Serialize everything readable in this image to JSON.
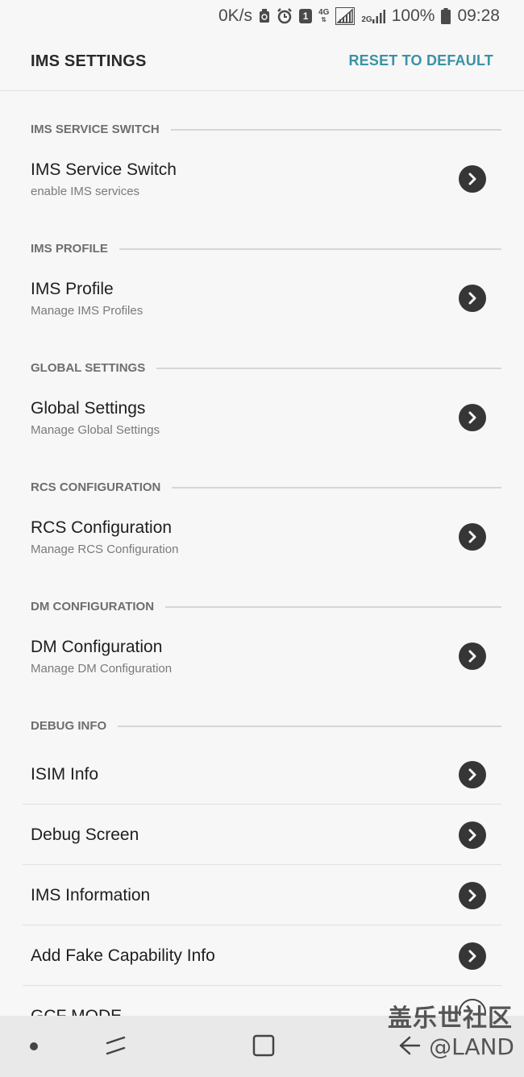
{
  "status_bar": {
    "speed": "0K/s",
    "sim_badge": "1",
    "net_4g": "4G",
    "net_2g": "2G",
    "battery": "100%",
    "time": "09:28",
    "icons": [
      "recycle-icon",
      "alarm-icon",
      "sim-icon",
      "signal-icon",
      "signal-2g-icon",
      "battery-icon"
    ]
  },
  "header": {
    "title": "IMS SETTINGS",
    "action": "RESET TO DEFAULT",
    "action_color": "#3a92a6"
  },
  "sections": [
    {
      "title": "IMS SERVICE SWITCH",
      "items": [
        {
          "title": "IMS Service Switch",
          "subtitle": "enable IMS services"
        }
      ]
    },
    {
      "title": "IMS PROFILE",
      "items": [
        {
          "title": "IMS Profile",
          "subtitle": "Manage IMS Profiles"
        }
      ]
    },
    {
      "title": "GLOBAL SETTINGS",
      "items": [
        {
          "title": "Global Settings",
          "subtitle": "Manage Global Settings"
        }
      ]
    },
    {
      "title": "RCS CONFIGURATION",
      "items": [
        {
          "title": "RCS Configuration",
          "subtitle": "Manage RCS Configuration"
        }
      ]
    },
    {
      "title": "DM CONFIGURATION",
      "items": [
        {
          "title": "DM Configuration",
          "subtitle": "Manage DM Configuration"
        }
      ]
    },
    {
      "title": "DEBUG INFO",
      "items": [
        {
          "title": "ISIM Info"
        },
        {
          "title": "Debug Screen"
        },
        {
          "title": "IMS Information"
        },
        {
          "title": "Add Fake Capability Info"
        },
        {
          "title": "GCF MODE"
        }
      ]
    }
  ],
  "nav_bar": {
    "icons": [
      "recent-apps-dot-icon",
      "recents-icon",
      "home-icon",
      "back-icon"
    ]
  },
  "watermark": {
    "line1": "盖乐世社区",
    "line2": "@LAND"
  }
}
